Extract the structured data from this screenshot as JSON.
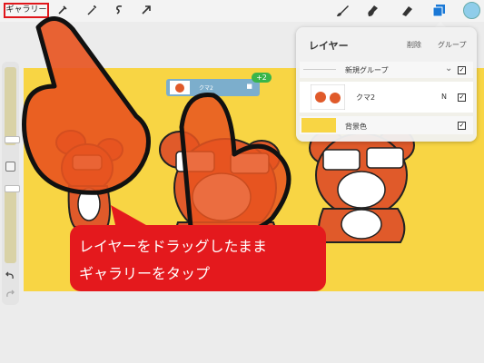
{
  "toolbar": {
    "gallery_label": "ギャラリー",
    "color_swatch": "#8fcdea"
  },
  "layers_panel": {
    "title": "レイヤー",
    "delete_label": "削除",
    "group_label": "グループ",
    "rows": [
      {
        "name": "新規グループ",
        "checked": true
      },
      {
        "name": "クマ2",
        "blend_mode": "N",
        "checked": true
      },
      {
        "name": "背景色",
        "checked": true
      }
    ]
  },
  "drag": {
    "count_badge": "+2",
    "layer_name": "クマ2"
  },
  "tooltip": {
    "line1": "レイヤーをドラッグしたまま",
    "line2": "ギャラリーをタップ"
  },
  "colors": {
    "canvas_bg": "#f8d544",
    "accent_red": "#e4191d",
    "hand_orange": "#e8531f"
  }
}
